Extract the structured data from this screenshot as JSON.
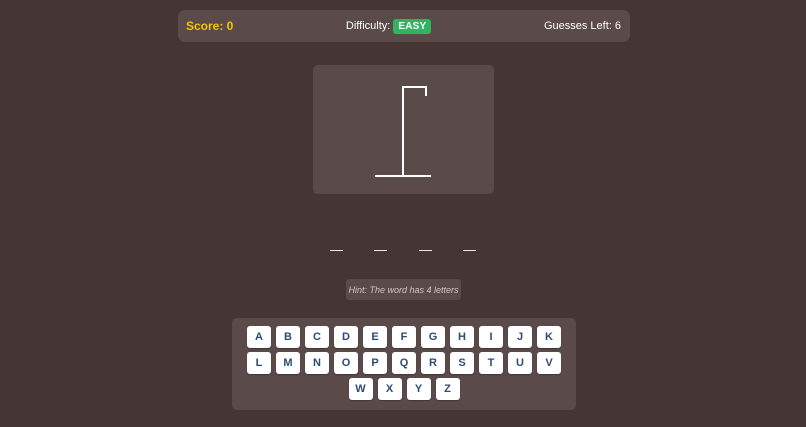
{
  "status": {
    "score_label": "Score: 0",
    "difficulty_label": "Difficulty:",
    "difficulty_value": "EASY",
    "guesses_left_label": "Guesses Left: 6"
  },
  "word": {
    "slots": [
      "",
      "",
      "",
      ""
    ]
  },
  "hint": "Hint: The word has 4 letters",
  "keyboard": {
    "rows": [
      [
        "A",
        "B",
        "C",
        "D",
        "E",
        "F",
        "G",
        "H",
        "I",
        "J",
        "K"
      ],
      [
        "L",
        "M",
        "N",
        "O",
        "P",
        "Q",
        "R",
        "S",
        "T",
        "U",
        "V"
      ],
      [
        "W",
        "X",
        "Y",
        "Z"
      ]
    ]
  },
  "colors": {
    "background": "#453535",
    "panel": "#5a4a49",
    "score": "#f2c500",
    "easy_badge": "#2fb561",
    "key_text": "#2e4a76"
  }
}
